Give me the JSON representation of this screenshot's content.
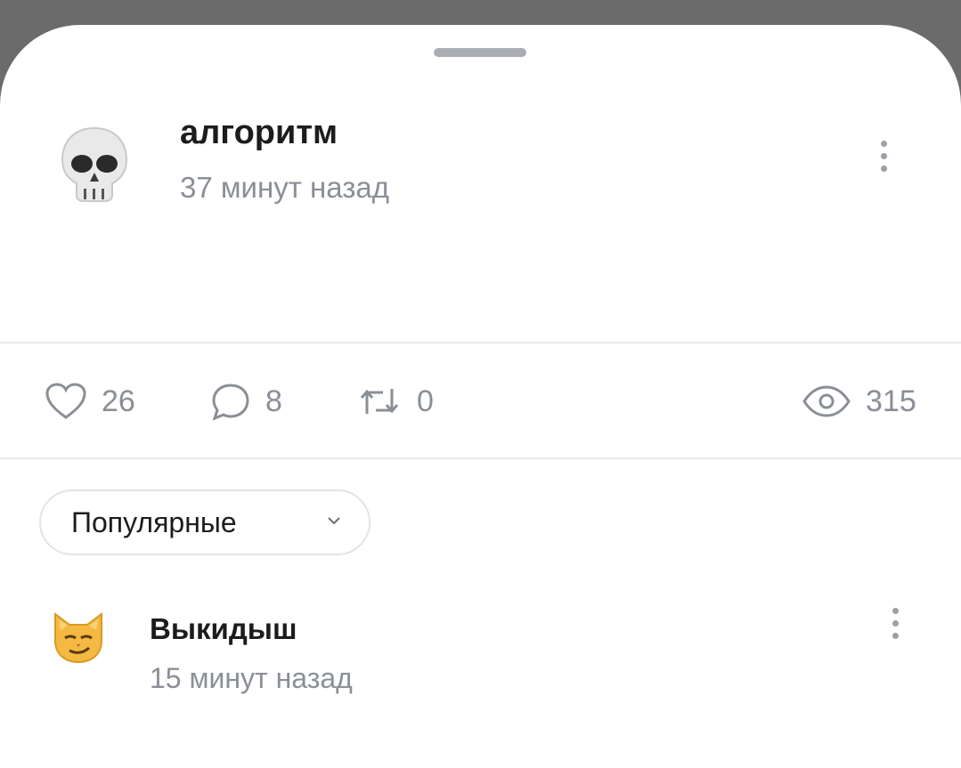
{
  "post": {
    "author": "алгоритм",
    "time": "37 минут назад",
    "avatar_icon": "skull-emoji",
    "body": ""
  },
  "actions": {
    "likes": "26",
    "comments": "8",
    "reposts": "0",
    "views": "315"
  },
  "sort": {
    "label": "Популярные",
    "chevron_icon": "chevron-down-icon"
  },
  "comments": [
    {
      "author": "Выкидыш",
      "time": "15 минут назад",
      "avatar_icon": "smirking-cat-emoji",
      "body": ""
    }
  ],
  "colors": {
    "text": "#1c1c1e",
    "muted": "#8a8f96",
    "divider": "#e6e8eb",
    "backdrop": "#6b6b6b"
  }
}
